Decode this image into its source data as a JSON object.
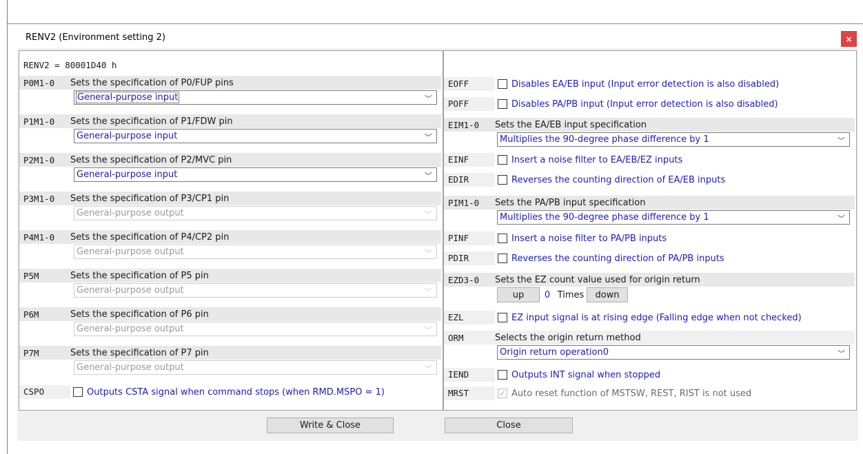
{
  "window": {
    "title": "RENV2 (Environment setting 2)",
    "close_glyph": "×"
  },
  "register": {
    "text": "RENV2 =  80001D40 h"
  },
  "left_rows": [
    {
      "label": "P0M1-0",
      "desc": "Sets the specification of P0/FUP pins",
      "value": "General-purpose input",
      "enabled": true,
      "focused": true
    },
    {
      "label": "P1M1-0",
      "desc": "Sets the specification of P1/FDW pin",
      "value": "General-purpose input",
      "enabled": true
    },
    {
      "label": "P2M1-0",
      "desc": "Sets the specification of P2/MVC pin",
      "value": "General-purpose input",
      "enabled": true
    },
    {
      "label": "P3M1-0",
      "desc": "Sets the specification of P3/CP1 pin",
      "value": "General-purpose output",
      "enabled": false
    },
    {
      "label": "P4M1-0",
      "desc": "Sets the specification of P4/CP2 pin",
      "value": "General-purpose output",
      "enabled": false
    },
    {
      "label": "P5M",
      "desc": "Sets the specification of P5 pin",
      "value": "General-purpose output",
      "enabled": false
    },
    {
      "label": "P6M",
      "desc": "Sets the specification of P6 pin",
      "value": "General-purpose output",
      "enabled": false
    },
    {
      "label": "P7M",
      "desc": "Sets the specification of P7 pin",
      "value": "General-purpose output",
      "enabled": false
    }
  ],
  "cspo": {
    "label": "CSPO",
    "text": "Outputs CSTA signal when command stops (when RMD.MSPO = 1)",
    "checked": false
  },
  "right": {
    "eoff": {
      "label": "EOFF",
      "text": "Disables EA/EB input (Input error detection is also disabled)"
    },
    "poff": {
      "label": "POFF",
      "text": "Disables PA/PB input (Input error detection is also disabled)"
    },
    "eim": {
      "label": "EIM1-0",
      "desc": "Sets the EA/EB input specification",
      "value": "Multiplies the 90-degree phase difference by 1"
    },
    "einf": {
      "label": "EINF",
      "text": "Insert a noise filter to EA/EB/EZ inputs"
    },
    "edir": {
      "label": "EDIR",
      "text": "Reverses the counting direction of EA/EB inputs"
    },
    "pim": {
      "label": "PIM1-0",
      "desc": "Sets the PA/PB input specification",
      "value": "Multiplies the 90-degree phase difference by 1"
    },
    "pinf": {
      "label": "PINF",
      "text": "Insert a noise filter to PA/PB inputs"
    },
    "pdir": {
      "label": "PDIR",
      "text": "Reverses the counting direction of PA/PB inputs"
    },
    "ezd": {
      "label": "EZD3-0",
      "desc": "Sets the EZ count value used for origin return",
      "up": "up",
      "value": "0",
      "unit": "Times",
      "down": "down"
    },
    "ezl": {
      "label": "EZL",
      "text": "EZ input signal is at rising edge (Falling edge when not checked)"
    },
    "orm": {
      "label": "ORM",
      "desc": "Selects the origin return method",
      "value": "Origin return operation0"
    },
    "iend": {
      "label": "IEND",
      "text": "Outputs INT signal when stopped"
    },
    "mrst": {
      "label": "MRST",
      "text": "Auto reset function of MSTSW, REST, RIST is not used",
      "check_glyph": "✓"
    }
  },
  "buttons": {
    "write_close": "Write  &  Close",
    "close": "Close"
  },
  "icons": {
    "dropdown": "chevron-down-icon",
    "chevron_glyph": "﹀"
  }
}
